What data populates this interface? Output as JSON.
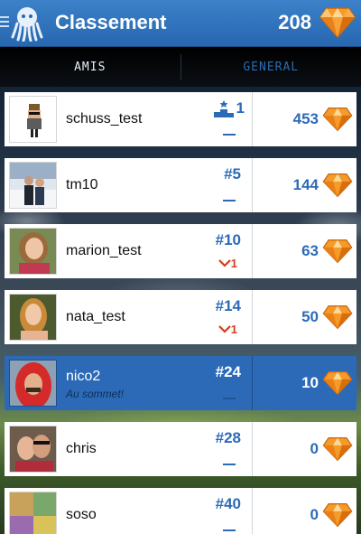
{
  "header": {
    "title": "Classement",
    "gem_count": "208"
  },
  "tabs": [
    {
      "label": "AMIS",
      "active": false
    },
    {
      "label": "GENERAL",
      "active": true
    }
  ],
  "rows": [
    {
      "name": "schuss_test",
      "subtitle": "",
      "rank": "1",
      "rank_icon": "podium-icon",
      "trend": "–",
      "score": "453",
      "highlight": false
    },
    {
      "name": "tm10",
      "subtitle": "",
      "rank": "#5",
      "trend": "–",
      "score": "144",
      "highlight": false
    },
    {
      "name": "marion_test",
      "subtitle": "",
      "rank": "#10",
      "trend": "1",
      "trend_dir": "down",
      "score": "63",
      "highlight": false
    },
    {
      "name": "nata_test",
      "subtitle": "",
      "rank": "#14",
      "trend": "1",
      "trend_dir": "down",
      "score": "50",
      "highlight": false
    },
    {
      "name": "nico2",
      "subtitle": "Au sommet!",
      "rank": "#24",
      "trend": "–",
      "score": "10",
      "highlight": true
    },
    {
      "name": "chris",
      "subtitle": "",
      "rank": "#28",
      "trend": "–",
      "score": "0",
      "highlight": false
    },
    {
      "name": "soso",
      "subtitle": "",
      "rank": "#40",
      "trend": "–",
      "score": "0",
      "highlight": false
    }
  ],
  "colors": {
    "brand_blue": "#2c6ab8",
    "trend_down": "#d63c17",
    "gem_orange": "#f59b2a"
  }
}
